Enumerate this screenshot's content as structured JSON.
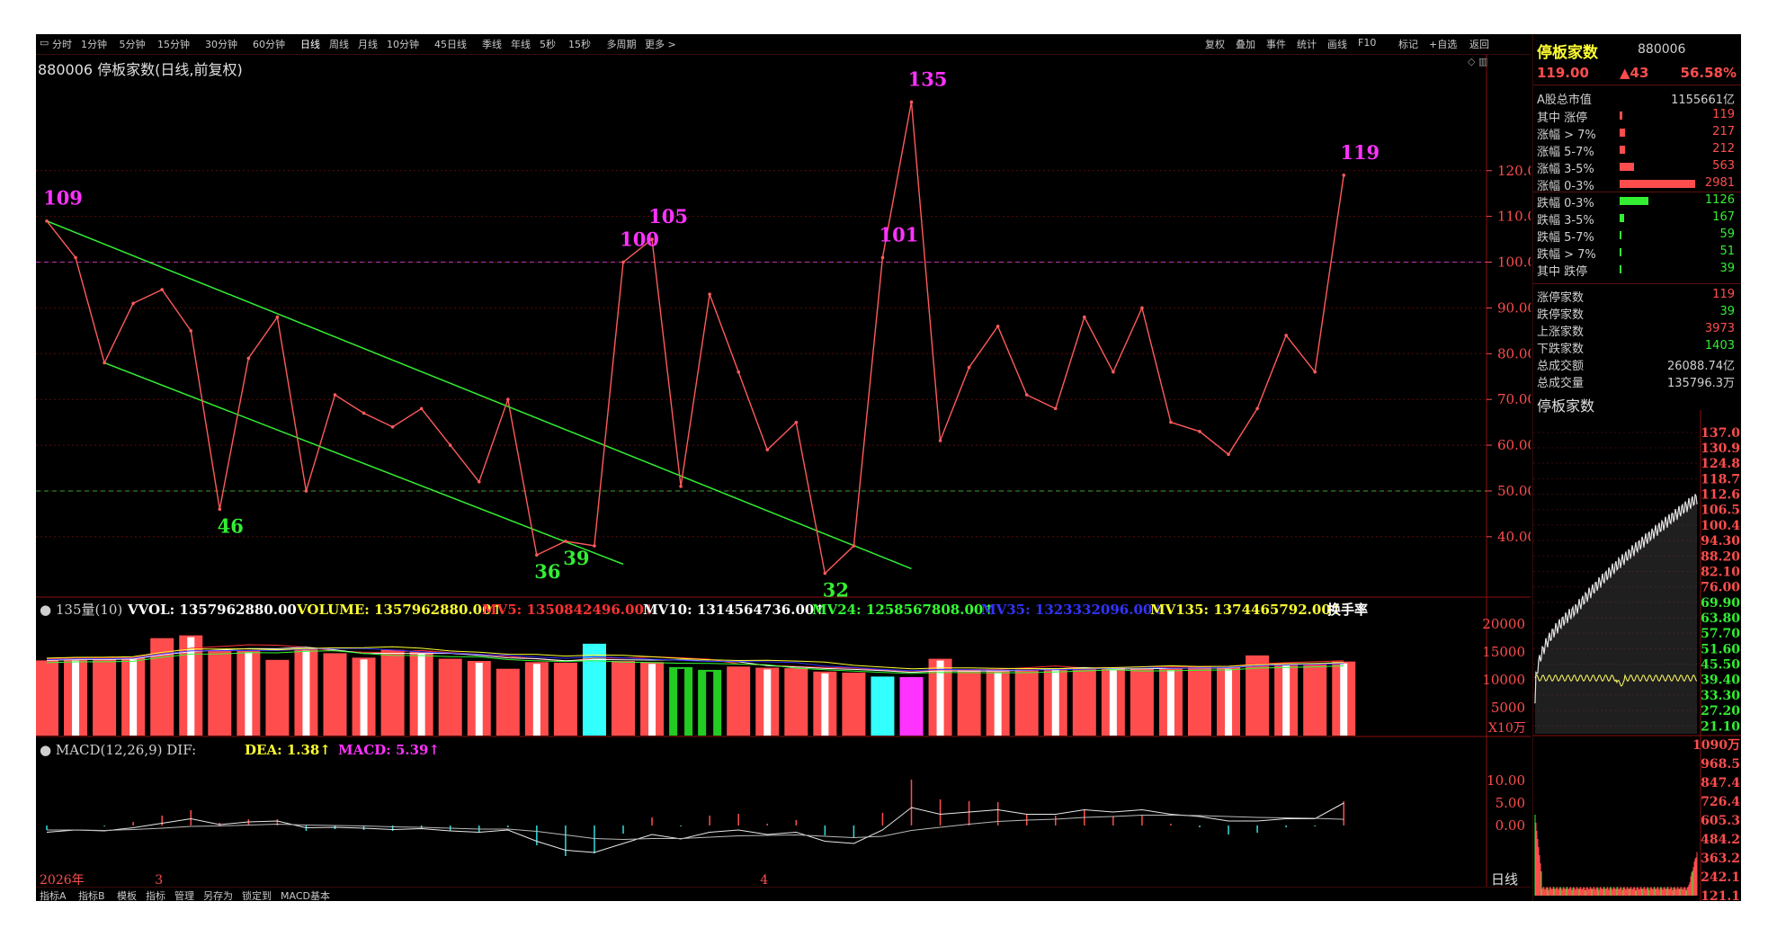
{
  "toolbar": {
    "periods": [
      "分时",
      "1分钟",
      "5分钟",
      "15分钟",
      "30分钟",
      "60分钟",
      "日线",
      "周线",
      "月线",
      "10分钟",
      "45日线",
      "季线",
      "年线",
      "5秒",
      "15秒",
      "多周期",
      "更多 >"
    ],
    "active_period": "日线",
    "actions": [
      "复权",
      "叠加",
      "事件",
      "统计",
      "画线",
      "F10",
      "标记",
      "+自选",
      "返回"
    ]
  },
  "title": "880006 停板家数(日线,前复权)",
  "colors": {
    "background": "#000000",
    "line": "#ff5a5a",
    "channel": "#33ee33",
    "peak_label": "#ff33ff",
    "trough_label": "#33ee33",
    "up_bar": "#ff4d4d",
    "down_bar": "#00ffff",
    "axis_text": "#ff4d4d"
  },
  "chart_data": [
    {
      "type": "line",
      "title": "880006 停板家数(日线,前复权)",
      "values": [
        109,
        101,
        78,
        91,
        94,
        85,
        46,
        79,
        88,
        50,
        71,
        67,
        64,
        68,
        60,
        52,
        70,
        36,
        39,
        38,
        100,
        105,
        51,
        93,
        76,
        59,
        65,
        32,
        38,
        101,
        135,
        61,
        77,
        86,
        71,
        68,
        88,
        76,
        90,
        65,
        63,
        58,
        68,
        84,
        76,
        119
      ],
      "annotations": [
        {
          "index": 0,
          "text": "109",
          "kind": "peak"
        },
        {
          "index": 6,
          "text": "46",
          "kind": "trough"
        },
        {
          "index": 17,
          "text": "36",
          "kind": "trough"
        },
        {
          "index": 18,
          "text": "39",
          "kind": "trough"
        },
        {
          "index": 20,
          "text": "100",
          "kind": "peak"
        },
        {
          "index": 21,
          "text": "105",
          "kind": "peak"
        },
        {
          "index": 27,
          "text": "32",
          "kind": "trough"
        },
        {
          "index": 29,
          "text": "101",
          "kind": "peak"
        },
        {
          "index": 30,
          "text": "135",
          "kind": "peak"
        },
        {
          "index": 45,
          "text": "119",
          "kind": "peak"
        }
      ],
      "channel_lines": [
        {
          "from": {
            "index": 0,
            "value": 109
          },
          "to": {
            "index": 30,
            "value": 33
          }
        },
        {
          "from": {
            "index": 2,
            "value": 78
          },
          "to": {
            "index": 20,
            "value": 34
          }
        }
      ],
      "reference_lines": [
        100,
        50
      ],
      "y_ticks": [
        "120.0",
        "110.0",
        "100.0",
        "90.00",
        "80.00",
        "70.00",
        "60.00",
        "50.00",
        "40.00"
      ],
      "ylim": [
        27,
        140
      ]
    },
    {
      "type": "bar",
      "legend": [
        {
          "text": "135量(10)",
          "color": "#cfcfcf"
        },
        {
          "text": "VVOL: 1357962880.00",
          "color": "#ffffff"
        },
        {
          "text": "VOLUME: 1357962880.00",
          "color": "#ffff33"
        },
        {
          "text": "MV5: 1350842496.00",
          "color": "#ff3333"
        },
        {
          "text": "MV10: 1314564736.00",
          "color": "#ffffff"
        },
        {
          "text": "MV24: 1258567808.00",
          "color": "#33ff33"
        },
        {
          "text": "MV35: 1323332096.00",
          "color": "#3333ff"
        },
        {
          "text": "MV135: 1374465792.00",
          "color": "#ffff33"
        },
        {
          "text": "换手率",
          "color": "#ffffff"
        }
      ],
      "values": [
        1350,
        1380,
        1370,
        1400,
        1750,
        1800,
        1520,
        1530,
        1360,
        1560,
        1480,
        1400,
        1540,
        1510,
        1380,
        1340,
        1200,
        1320,
        1310,
        1650,
        1340,
        1320,
        1230,
        1180,
        1240,
        1220,
        1210,
        1150,
        1130,
        1060,
        1050,
        1380,
        1180,
        1170,
        1190,
        1210,
        1200,
        1220,
        1200,
        1210,
        1240,
        1230,
        1440,
        1300,
        1290,
        1330
      ],
      "bar_colors": [
        "#ff4d4d",
        "#ff4d4d",
        "#ff4d4d",
        "#ff4d4d",
        "#ff4d4d",
        "#ff4d4d",
        "#ff4d4d",
        "#ff4d4d",
        "#ff4d4d",
        "#ff4d4d",
        "#ff4d4d",
        "#ff4d4d",
        "#ff4d4d",
        "#ff4d4d",
        "#ff4d4d",
        "#ff4d4d",
        "#ff4d4d",
        "#ff4d4d",
        "#ff4d4d",
        "#33ffff",
        "#ff4d4d",
        "#ff4d4d",
        "#22cc22",
        "#22cc22",
        "#ff4d4d",
        "#ff4d4d",
        "#ff4d4d",
        "#ff4d4d",
        "#ff4d4d",
        "#33ffff",
        "#ff33ff",
        "#ff4d4d",
        "#ff4d4d",
        "#ff4d4d",
        "#ff4d4d",
        "#ff4d4d",
        "#ff4d4d",
        "#ff4d4d",
        "#ff4d4d",
        "#ff4d4d",
        "#ff4d4d",
        "#ff4d4d",
        "#ff4d4d",
        "#ff4d4d",
        "#ff4d4d",
        "#ff4d4d"
      ],
      "y_ticks": [
        "20000",
        "15000",
        "10000",
        "5000"
      ],
      "unit": "X10万",
      "ylim": [
        0,
        2100
      ]
    },
    {
      "type": "line",
      "legend": [
        {
          "text": "MACD(12,26,9) DIF:",
          "color": "#cfcfcf"
        },
        {
          "text": "DEA: 1.38",
          "color": "#ffff33"
        },
        {
          "text": "MACD: 5.39",
          "color": "#ff33ff"
        }
      ],
      "y_ticks": [
        "10.00",
        "5.00",
        "0.00"
      ],
      "ylim": [
        -10,
        14
      ],
      "dif": [
        -1.5,
        -1.0,
        -1.2,
        -0.5,
        0.5,
        1.5,
        0.2,
        0.8,
        1.0,
        -0.5,
        -0.4,
        -0.6,
        -0.9,
        -0.7,
        -1.2,
        -1.5,
        -1.0,
        -3.5,
        -5.5,
        -6.0,
        -4.0,
        -2.0,
        -3.0,
        -1.5,
        -1.0,
        -2.0,
        -1.5,
        -3.5,
        -4.0,
        -1.0,
        4.0,
        2.5,
        3.0,
        3.5,
        2.5,
        2.5,
        3.5,
        3.0,
        3.5,
        2.5,
        2.0,
        1.0,
        1.0,
        1.5,
        1.5,
        5.0
      ],
      "dea": [
        -1.0,
        -1.0,
        -1.1,
        -0.9,
        -0.6,
        -0.2,
        -0.1,
        0.1,
        0.3,
        0.1,
        0.0,
        -0.1,
        -0.3,
        -0.4,
        -0.6,
        -0.8,
        -0.8,
        -1.3,
        -2.1,
        -2.9,
        -3.1,
        -2.9,
        -2.9,
        -2.6,
        -2.3,
        -2.2,
        -2.1,
        -2.4,
        -2.7,
        -2.4,
        -1.1,
        -0.4,
        0.3,
        0.9,
        1.2,
        1.4,
        1.8,
        2.0,
        2.3,
        2.3,
        2.2,
        2.0,
        1.8,
        1.7,
        1.6,
        1.38
      ],
      "macd": [
        -1.0,
        0.0,
        -0.2,
        0.8,
        2.2,
        3.4,
        0.6,
        1.4,
        1.4,
        -1.2,
        -0.8,
        -1.0,
        -1.2,
        -0.6,
        -1.2,
        -1.4,
        -0.4,
        -4.4,
        -6.8,
        -6.2,
        -1.8,
        1.8,
        -0.2,
        2.2,
        2.6,
        0.4,
        1.2,
        -2.2,
        -2.6,
        2.8,
        10.2,
        5.8,
        5.4,
        5.2,
        2.6,
        2.2,
        3.4,
        2.0,
        2.4,
        0.4,
        -0.4,
        -2.0,
        -1.6,
        -0.4,
        -0.2,
        5.39
      ]
    },
    {
      "type": "line",
      "title": "停板家数",
      "y_ticks": [
        "137.0",
        "130.9",
        "124.8",
        "118.7",
        "112.6",
        "106.5",
        "100.4",
        "94.30",
        "88.20",
        "82.10",
        "76.00",
        "69.90",
        "63.80",
        "57.70",
        "51.60",
        "45.50",
        "39.40",
        "33.30",
        "27.20",
        "21.10"
      ],
      "volume_ticks": [
        "1090万",
        "968.5",
        "847.4",
        "726.4",
        "605.3",
        "484.2",
        "363.2",
        "242.1",
        "121.1"
      ],
      "ylim": [
        18,
        138
      ]
    }
  ],
  "x_labels": [
    {
      "index": 0,
      "text": "2026年"
    },
    {
      "index": 4,
      "text": "3"
    },
    {
      "index": 25,
      "text": "4"
    }
  ],
  "right_panel": {
    "name": "停板家数",
    "code": "880006",
    "price": "119.00",
    "change": "▲43",
    "change_pct": "56.58%",
    "market_cap_label": "A股总市值",
    "market_cap_value": "1155661亿",
    "dist_rows": [
      {
        "label": "其中 涨停",
        "value": "119",
        "bar": 0.04,
        "color": "#ff4d4d"
      },
      {
        "label": "涨幅 > 7%",
        "value": "217",
        "bar": 0.07,
        "color": "#ff4d4d"
      },
      {
        "label": "涨幅 5-7%",
        "value": "212",
        "bar": 0.07,
        "color": "#ff4d4d"
      },
      {
        "label": "涨幅 3-5%",
        "value": "563",
        "bar": 0.19,
        "color": "#ff4d4d"
      },
      {
        "label": "涨幅 0-3%",
        "value": "2981",
        "bar": 1.0,
        "color": "#ff4d4d"
      },
      {
        "label": "跌幅 0-3%",
        "value": "1126",
        "bar": 0.38,
        "color": "#33ee33"
      },
      {
        "label": "跌幅 3-5%",
        "value": "167",
        "bar": 0.06,
        "color": "#33ee33"
      },
      {
        "label": "跌幅 5-7%",
        "value": "59",
        "bar": 0.02,
        "color": "#33ee33"
      },
      {
        "label": "跌幅 > 7%",
        "value": "51",
        "bar": 0.02,
        "color": "#33ee33"
      },
      {
        "label": "其中 跌停",
        "value": "39",
        "bar": 0.015,
        "color": "#33ee33"
      }
    ],
    "stats": [
      {
        "label": "涨停家数",
        "value": "119",
        "color": "#ff4d4d"
      },
      {
        "label": "跌停家数",
        "value": "39",
        "color": "#33ee33"
      },
      {
        "label": "上涨家数",
        "value": "3973",
        "color": "#ff4d4d"
      },
      {
        "label": "下跌家数",
        "value": "1403",
        "color": "#33ee33"
      },
      {
        "label": "总成交额",
        "value": "26088.74亿",
        "color": "#d0d0d0"
      },
      {
        "label": "总成交量",
        "value": "135796.3万",
        "color": "#d0d0d0"
      }
    ]
  },
  "bottom_tabs": [
    "指标A",
    "指标B",
    "模板",
    "指标",
    "管理",
    "另存为",
    "锁定到",
    "MACD基本"
  ],
  "period_label": "日线"
}
